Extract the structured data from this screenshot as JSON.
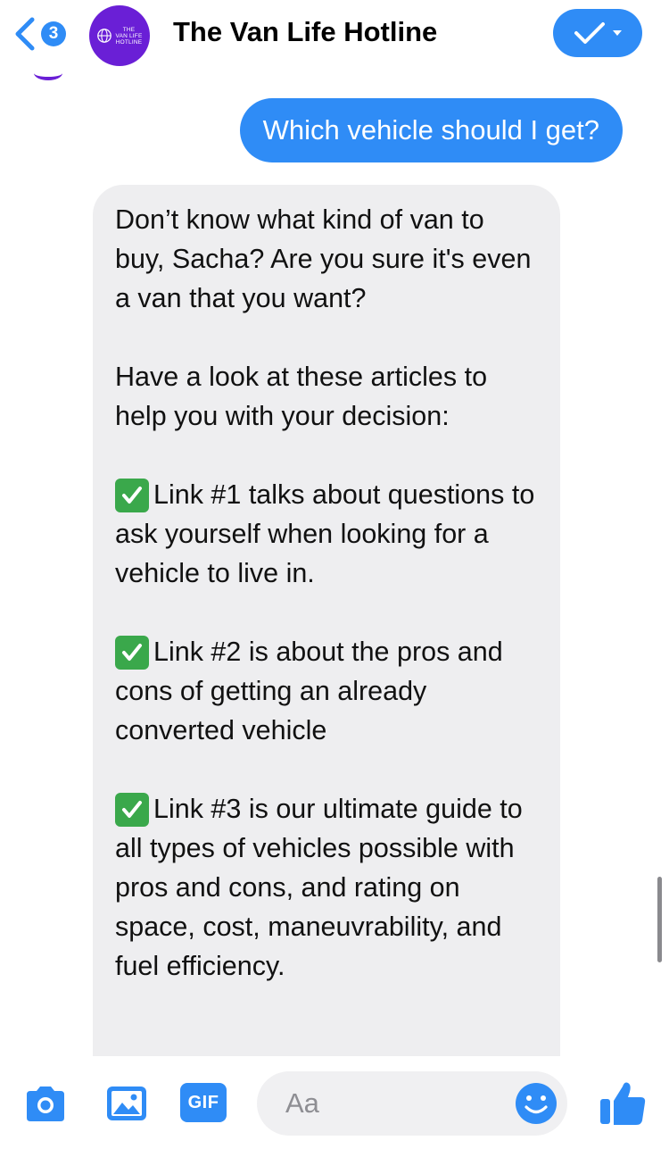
{
  "header": {
    "back_badge_count": "3",
    "avatar_text": "THE\nVAN LIFE\nHOTLINE",
    "title": "The Van Life Hotline",
    "back_icon": "chevron-left-icon",
    "action_icon": "checkmark-dropdown-icon"
  },
  "messages": {
    "sent": "Which vehicle should I get?",
    "received": [
      "Don’t know what kind of van to buy, Sacha? Are you sure it's even a van that you want?",
      "Have a look at these articles to help you with your decision:",
      "Link #1 talks about questions to ask yourself when looking for a vehicle to live in.",
      "Link #2 is about the pros and cons of getting an already converted vehicle",
      "Link #3 is our ultimate guide to all types of vehicles possible with pros and cons, and rating on space, cost, maneuvrability, and fuel efficiency."
    ]
  },
  "composer": {
    "gif_label": "GIF",
    "placeholder": "Aa",
    "icons": [
      "camera-icon",
      "photo-icon",
      "gif-icon",
      "smiley-icon",
      "thumbs-up-icon"
    ]
  },
  "colors": {
    "accent": "#2f8cf6",
    "avatar": "#6a1fd6",
    "bubble_received": "#eeeef0",
    "check_emoji": "#3aa84b"
  }
}
